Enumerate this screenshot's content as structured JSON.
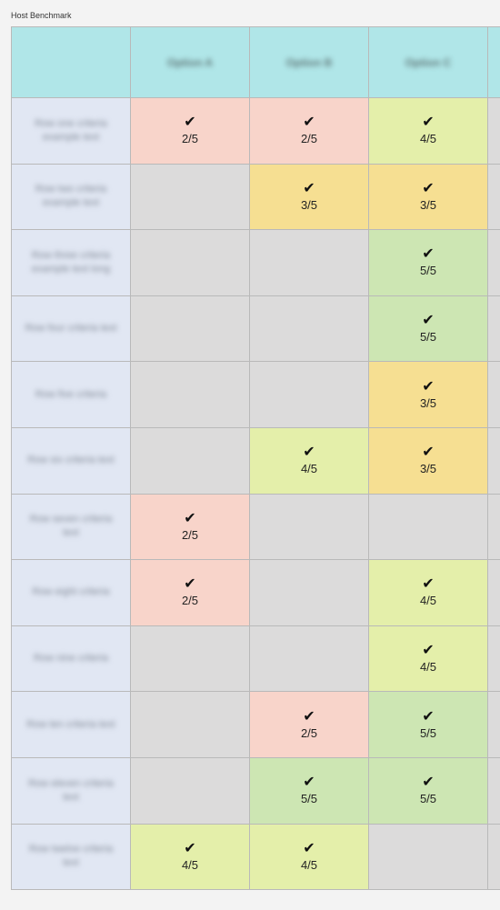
{
  "title": "Host Benchmark",
  "colors": {
    "empty": "#dcdbdb",
    "header": "#b0e6e8",
    "label": "#e1e7f3",
    "s2": "#f8d4ca",
    "s3": "#f6df92",
    "s4": "#e4efaa",
    "s5": "#cde6b3"
  },
  "headers": [
    "Option A",
    "Option B",
    "Option C"
  ],
  "rows": [
    {
      "label": "Row one criteria example text",
      "cells": [
        "2/5",
        "2/5",
        "4/5"
      ]
    },
    {
      "label": "Row two criteria example text",
      "cells": [
        "",
        "3/5",
        "3/5"
      ]
    },
    {
      "label": "Row three criteria example text long",
      "cells": [
        "",
        "",
        "5/5"
      ]
    },
    {
      "label": "Row four criteria text",
      "cells": [
        "",
        "",
        "5/5"
      ]
    },
    {
      "label": "Row five criteria",
      "cells": [
        "",
        "",
        "3/5"
      ]
    },
    {
      "label": "Row six criteria text",
      "cells": [
        "",
        "4/5",
        "3/5"
      ]
    },
    {
      "label": "Row seven criteria text",
      "cells": [
        "2/5",
        "",
        ""
      ]
    },
    {
      "label": "Row eight criteria",
      "cells": [
        "2/5",
        "",
        "4/5"
      ]
    },
    {
      "label": "Row nine criteria",
      "cells": [
        "",
        "",
        "4/5"
      ]
    },
    {
      "label": "Row ten criteria text",
      "cells": [
        "",
        "2/5",
        "5/5"
      ]
    },
    {
      "label": "Row eleven criteria text",
      "cells": [
        "",
        "5/5",
        "5/5"
      ]
    },
    {
      "label": "Row twelve criteria text",
      "cells": [
        "4/5",
        "4/5",
        ""
      ]
    }
  ],
  "rowColors": [
    [
      "s2",
      "s2",
      "s4"
    ],
    [
      "empty",
      "s3",
      "s3"
    ],
    [
      "empty",
      "empty",
      "s5"
    ],
    [
      "empty",
      "empty",
      "s5"
    ],
    [
      "empty",
      "empty",
      "s3"
    ],
    [
      "empty",
      "s4",
      "s3"
    ],
    [
      "s2",
      "empty",
      "empty"
    ],
    [
      "s2",
      "empty",
      "s4"
    ],
    [
      "empty",
      "empty",
      "s4"
    ],
    [
      "empty",
      "s2",
      "s5"
    ],
    [
      "empty",
      "s5",
      "s5"
    ],
    [
      "s4",
      "s4",
      "empty"
    ]
  ]
}
